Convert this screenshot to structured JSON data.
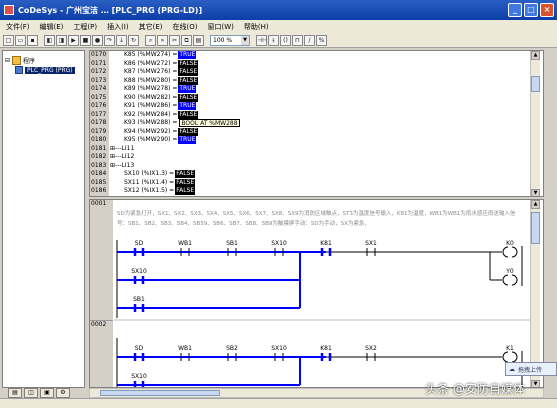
{
  "window": {
    "title": "CoDeSys - 广州宝洁 … [PLC_PRG (PRG-LD)]"
  },
  "menu": [
    "文件(F)",
    "编辑(E)",
    "工程(P)",
    "插入(I)",
    "其它(E)",
    "在线(O)",
    "窗口(W)",
    "帮助(H)"
  ],
  "toolbar": {
    "zoom": "100 %",
    "zoom_arrow": "▼"
  },
  "tree": {
    "root": "程序",
    "item": "PLC_PRG (PRG)"
  },
  "declarations": [
    {
      "line": "0170",
      "text": "K85 (%MW274) =",
      "value": "TRUE",
      "state": "t"
    },
    {
      "line": "0171",
      "text": "K86 (%MW272) =",
      "value": "FALSE",
      "state": "f"
    },
    {
      "line": "0172",
      "text": "K87 (%MW276) =",
      "value": "FALSE",
      "state": "f"
    },
    {
      "line": "0173",
      "text": "K88 (%MW280) =",
      "value": "FALSE",
      "state": "f"
    },
    {
      "line": "0174",
      "text": "K89 (%MW278) =",
      "value": "TRUE",
      "state": "t"
    },
    {
      "line": "0175",
      "text": "K90 (%MW282) =",
      "value": "FALSE",
      "state": "f"
    },
    {
      "line": "0176",
      "text": "K91 (%MW286) =",
      "value": "TRUE",
      "state": "t"
    },
    {
      "line": "0177",
      "text": "K92 (%MW284) =",
      "value": "FALSE",
      "state": "f"
    },
    {
      "line": "0178",
      "text": "K93 (%MW288) =",
      "value": "BOOL AT %MW288",
      "state": "tip"
    },
    {
      "line": "0179",
      "text": "K94 (%MW292) =",
      "value": "FALSE",
      "state": "f"
    },
    {
      "line": "0180",
      "text": "K95 (%MW290) =",
      "value": "TRUE",
      "state": "t"
    },
    {
      "line": "0181",
      "text": "⊞---LI11",
      "value": "",
      "state": ""
    },
    {
      "line": "0182",
      "text": "⊞---LI12",
      "value": "",
      "state": ""
    },
    {
      "line": "0183",
      "text": "⊞---LI13",
      "value": "",
      "state": ""
    },
    {
      "line": "0184",
      "text": "SX10 (%IX1.3) =",
      "value": "FALSE",
      "state": "f"
    },
    {
      "line": "0185",
      "text": "SX11 (%IX1.4) =",
      "value": "FALSE",
      "state": "f"
    },
    {
      "line": "0186",
      "text": "SX12 (%IX1.5) =",
      "value": "FALSE",
      "state": "f"
    }
  ],
  "networks": [
    {
      "number": "0001",
      "comment": "SD为紧急打开，SX1、SX2、SX3、SX4、SX5、SX6、SX7、SX8、SX9为消防区域触点，ST3为温度信号输入，K81为温度，WB1为WB1为雨水感应雨送输入信号：SB1、SB2、SB3、SB4、SB59、SB6、SB7、SB8、SB9为触摸屏手动：SD为手动，SX为紧急，",
      "contacts": [
        "SD",
        "WB1",
        "SB1",
        "SX10",
        "K81",
        "SX1"
      ],
      "parallel": [
        "SX10",
        "SB1"
      ],
      "coils": [
        "K0",
        "Y0"
      ]
    },
    {
      "number": "0002",
      "comment": "",
      "contacts": [
        "SD",
        "WB1",
        "SB2",
        "SX10",
        "K81",
        "SX2"
      ],
      "parallel": [
        "SX10"
      ],
      "coils": [
        "K1"
      ]
    }
  ],
  "popup": {
    "text": "拖拽上传"
  },
  "watermark": "头条 @安防自媒体"
}
